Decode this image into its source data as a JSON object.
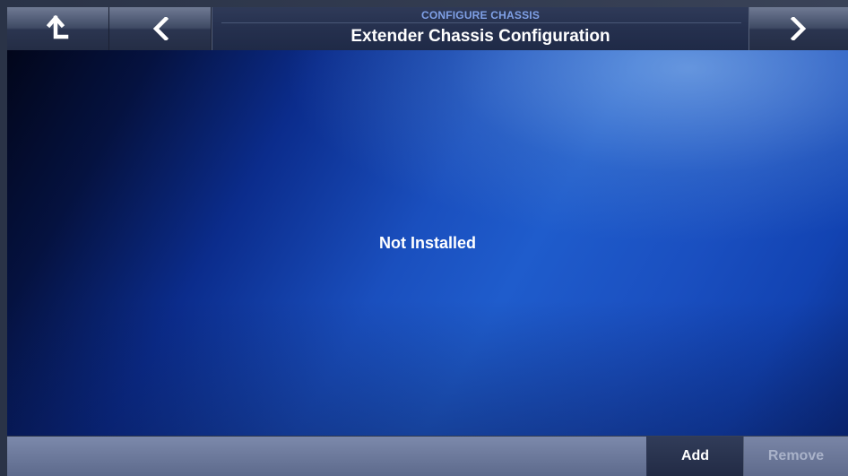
{
  "header": {
    "subtitle": "CONFIGURE CHASSIS",
    "title": "Extender Chassis Configuration",
    "up_icon": "up-arrow-icon",
    "back_icon": "chevron-left-icon",
    "next_icon": "chevron-right-icon"
  },
  "main": {
    "status": "Not Installed"
  },
  "footer": {
    "add_label": "Add",
    "remove_label": "Remove"
  },
  "colors": {
    "accent_subtitle": "#7fa0e6",
    "content_blue": "#1f5ccc",
    "header_dark": "#25304e"
  }
}
